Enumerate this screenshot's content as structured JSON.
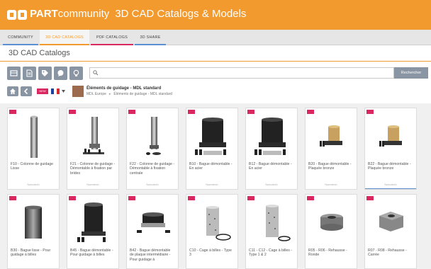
{
  "header": {
    "brand_bold": "PART",
    "brand_light": "community",
    "title": "3D CAD Catalogs & Models"
  },
  "tabs": [
    {
      "label": "COMMUNITY",
      "color": "#5a8fd1"
    },
    {
      "label": "3D CAD CATALOGS",
      "color": "#f39a2e",
      "active": true
    },
    {
      "label": "PDF CATALOGS",
      "color": "#d9285f"
    },
    {
      "label": "3D SHARE",
      "color": "#5a8fd1"
    }
  ],
  "page_title": "3D CAD Catalogs",
  "toolbar": {
    "icons": [
      "catalog-icon",
      "document-icon",
      "tag-icon",
      "chat-icon",
      "bulb-icon"
    ],
    "search_placeholder": "",
    "search_button": "Rechercher"
  },
  "breadcrumb": {
    "title": "Éléments de guidage - MDL standard",
    "path": [
      "MDL Europe",
      "Éléments de guidage - MDL standard"
    ],
    "lang_badge": "NEW"
  },
  "products": [
    {
      "label": "F10 - Colonne de guidage Lisse",
      "footer": "Nomotech"
    },
    {
      "label": "F21 - Colonne de guidage - Démontable à fixation par brides",
      "footer": "Nomotech"
    },
    {
      "label": "F22 - Colonne de guidage - Démontable à fixation centrale",
      "footer": "Nomotech"
    },
    {
      "label": "B10 - Bague démontable - En acier",
      "footer": "Nomotech"
    },
    {
      "label": "B12 - Bague démontable - En acier",
      "footer": "Nomotech"
    },
    {
      "label": "B20 - Bague démontable - Plaquée bronze",
      "footer": "Nomotech"
    },
    {
      "label": "B22 - Bague démontable - Plaquée bronze",
      "footer": "Nomotech"
    },
    {
      "label": "B30 - Bague lisse - Pour guidage à billes",
      "footer": ""
    },
    {
      "label": "B45 - Bague démontable - Pour guidage à billes",
      "footer": ""
    },
    {
      "label": "B42 - Bague démontable de plaque intermédiaire - Pour guidage à",
      "footer": ""
    },
    {
      "label": "C10 - Cage à billes - Type 3",
      "footer": ""
    },
    {
      "label": "C11 - C12 - Cage à billes - Type 1 & 2",
      "footer": ""
    },
    {
      "label": "R05 - R06 - Rehausse - Ronde",
      "footer": ""
    },
    {
      "label": "R07 - R08 - Rehausse - Carrée",
      "footer": ""
    }
  ],
  "colors": {
    "brand_orange": "#f39a2e",
    "tag_pink": "#d9285f",
    "button_gray": "#8a95a3"
  }
}
